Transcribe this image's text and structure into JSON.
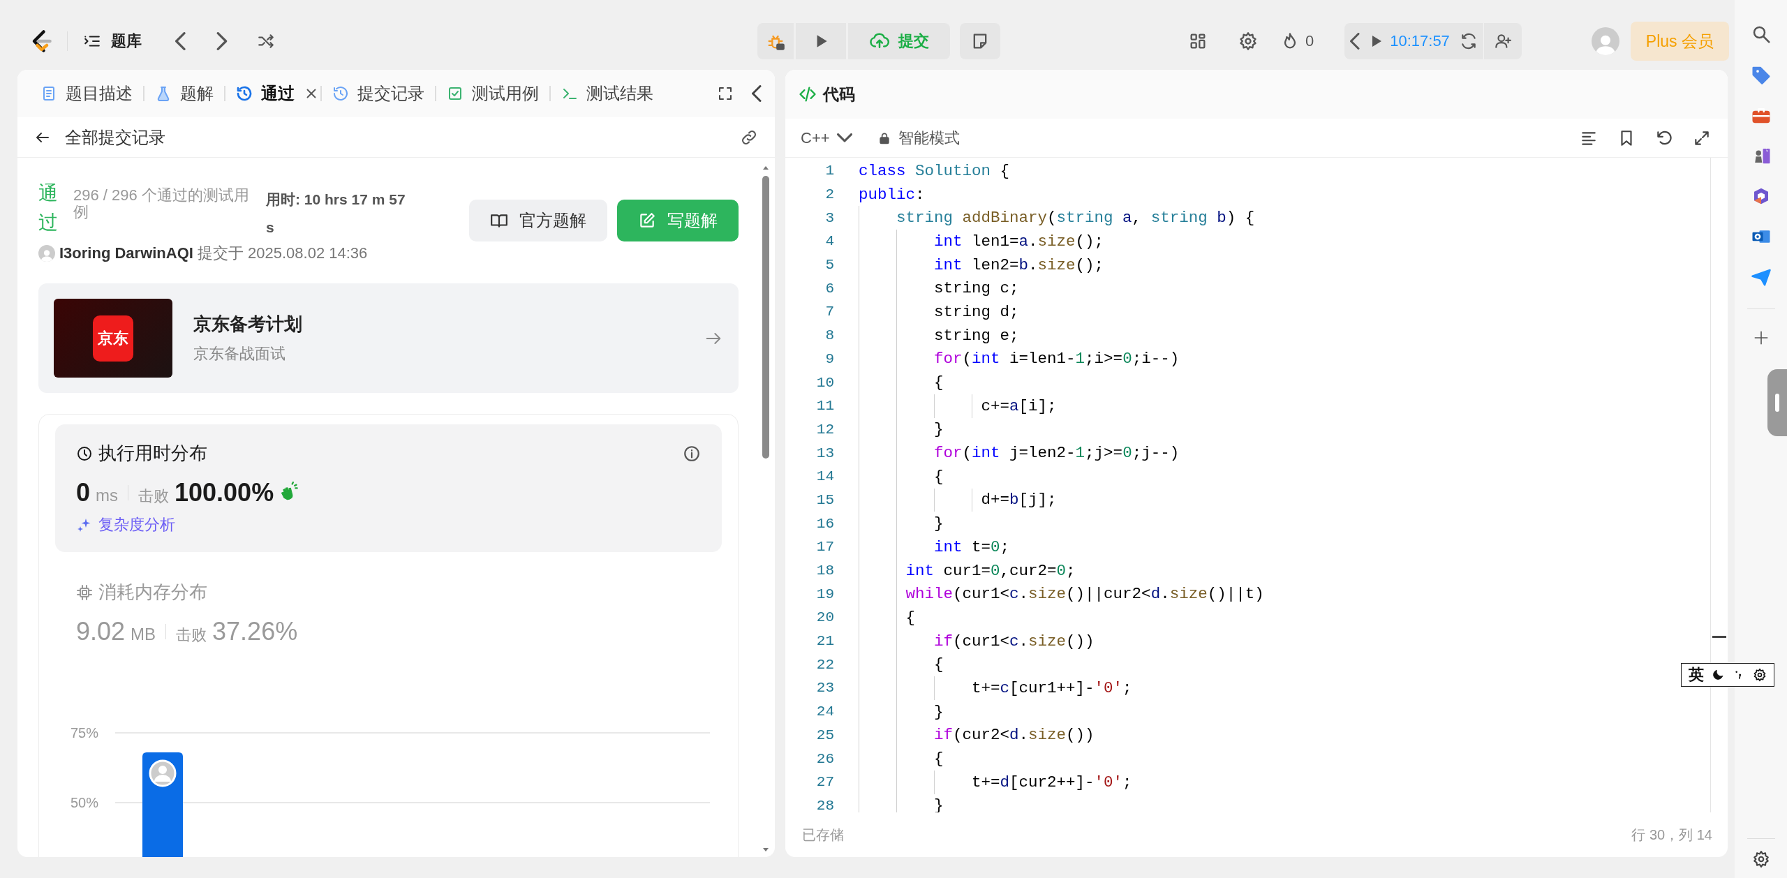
{
  "nav": {
    "bank_label": "题库",
    "submit_label": "提交",
    "streak_count": "0",
    "timer": "10:17:57",
    "plus_label": "Plus 会员"
  },
  "left_tabs": [
    {
      "label": "题目描述",
      "kind": "doc",
      "selected": false,
      "closable": false
    },
    {
      "label": "题解",
      "kind": "flask",
      "selected": false,
      "closable": false
    },
    {
      "label": "通过",
      "kind": "history",
      "selected": true,
      "closable": true
    },
    {
      "label": "提交记录",
      "kind": "history",
      "selected": false,
      "closable": false
    },
    {
      "label": "测试用例",
      "kind": "checkbox",
      "selected": false,
      "closable": false
    },
    {
      "label": "测试结果",
      "kind": "terminal",
      "selected": false,
      "closable": false
    }
  ],
  "submission_header": {
    "back_label": "全部提交记录"
  },
  "result": {
    "status": "通过",
    "cases": "296 / 296 个通过的测试用例",
    "runtime": "用时: 10 hrs 17 m 57 s",
    "official_button": "官方题解",
    "write_button": "写题解",
    "author": "I3oring DarwinAQI",
    "submitted": "提交于 2025.08.02 14:36"
  },
  "promo": {
    "logo_text": "京东",
    "title": "京东备考计划",
    "subtitle": "京东备战面试"
  },
  "stats": [
    {
      "title": "执行用时分布",
      "value": "0",
      "unit": "ms",
      "beats_label": "击败",
      "beats": "100.00%",
      "analysis_link": "复杂度分析",
      "kind": "runtime",
      "selected": true
    },
    {
      "title": "消耗内存分布",
      "value": "9.02",
      "unit": "MB",
      "beats_label": "击败",
      "beats": "37.26%",
      "kind": "memory",
      "selected": false
    }
  ],
  "distribution_chart": {
    "chart_data": {
      "type": "bar",
      "yticks": [
        {
          "value": 50,
          "label": "50%"
        },
        {
          "value": 75,
          "label": "75%"
        }
      ],
      "ylim": [
        25,
        75
      ],
      "values": [
        68
      ]
    }
  },
  "editor": {
    "title": "代码",
    "language": "C++",
    "mode": "智能模式",
    "status": "已存储",
    "cursor": "行 30，列 14",
    "lines": [
      {
        "number": "1",
        "tokens": [
          {
            "text": "class",
            "kind": "kw"
          },
          {
            "text": " Solution",
            "kind": "type"
          },
          {
            "text": " {",
            "kind": "plain"
          }
        ]
      },
      {
        "number": "2",
        "tokens": [
          {
            "text": "public",
            "kind": "kw"
          },
          {
            "text": ":",
            "kind": "plain"
          }
        ]
      },
      {
        "number": "3",
        "tokens": [
          {
            "text": "    string",
            "kind": "type"
          },
          {
            "text": " addBinary",
            "kind": "fn"
          },
          {
            "text": "(",
            "kind": "plain"
          },
          {
            "text": "string",
            "kind": "type"
          },
          {
            "text": " a",
            "kind": "var"
          },
          {
            "text": ", ",
            "kind": "plain"
          },
          {
            "text": "string",
            "kind": "type"
          },
          {
            "text": " b",
            "kind": "var"
          },
          {
            "text": ") {",
            "kind": "plain"
          }
        ]
      },
      {
        "number": "4",
        "tokens": [
          {
            "text": "        int",
            "kind": "kw"
          },
          {
            "text": " len1=",
            "kind": "plain"
          },
          {
            "text": "a",
            "kind": "var"
          },
          {
            "text": ".",
            "kind": "plain"
          },
          {
            "text": "size",
            "kind": "fn"
          },
          {
            "text": "();",
            "kind": "plain"
          }
        ]
      },
      {
        "number": "5",
        "tokens": [
          {
            "text": "        int",
            "kind": "kw"
          },
          {
            "text": " len2=",
            "kind": "plain"
          },
          {
            "text": "b",
            "kind": "var"
          },
          {
            "text": ".",
            "kind": "plain"
          },
          {
            "text": "size",
            "kind": "fn"
          },
          {
            "text": "();",
            "kind": "plain"
          }
        ]
      },
      {
        "number": "6",
        "tokens": [
          {
            "text": "        string c;",
            "kind": "plain"
          }
        ]
      },
      {
        "number": "7",
        "tokens": [
          {
            "text": "        string d;",
            "kind": "plain"
          }
        ]
      },
      {
        "number": "8",
        "tokens": [
          {
            "text": "        string e;",
            "kind": "plain"
          }
        ]
      },
      {
        "number": "9",
        "tokens": [
          {
            "text": "        for",
            "kind": "ctrl"
          },
          {
            "text": "(",
            "kind": "plain"
          },
          {
            "text": "int",
            "kind": "kw"
          },
          {
            "text": " i=len1-",
            "kind": "plain"
          },
          {
            "text": "1",
            "kind": "num"
          },
          {
            "text": ";i>=",
            "kind": "plain"
          },
          {
            "text": "0",
            "kind": "num"
          },
          {
            "text": ";i--)",
            "kind": "plain"
          }
        ]
      },
      {
        "number": "10",
        "tokens": [
          {
            "text": "        {",
            "kind": "plain"
          }
        ]
      },
      {
        "number": "11",
        "tokens": [
          {
            "text": "             c+=",
            "kind": "plain"
          },
          {
            "text": "a",
            "kind": "var"
          },
          {
            "text": "[i];",
            "kind": "plain"
          }
        ]
      },
      {
        "number": "12",
        "tokens": [
          {
            "text": "        }",
            "kind": "plain"
          }
        ]
      },
      {
        "number": "13",
        "tokens": [
          {
            "text": "        for",
            "kind": "ctrl"
          },
          {
            "text": "(",
            "kind": "plain"
          },
          {
            "text": "int",
            "kind": "kw"
          },
          {
            "text": " j=len2-",
            "kind": "plain"
          },
          {
            "text": "1",
            "kind": "num"
          },
          {
            "text": ";j>=",
            "kind": "plain"
          },
          {
            "text": "0",
            "kind": "num"
          },
          {
            "text": ";j--)",
            "kind": "plain"
          }
        ]
      },
      {
        "number": "14",
        "tokens": [
          {
            "text": "        {",
            "kind": "plain"
          }
        ]
      },
      {
        "number": "15",
        "tokens": [
          {
            "text": "             d+=",
            "kind": "plain"
          },
          {
            "text": "b",
            "kind": "var"
          },
          {
            "text": "[j];",
            "kind": "plain"
          }
        ]
      },
      {
        "number": "16",
        "tokens": [
          {
            "text": "        }",
            "kind": "plain"
          }
        ]
      },
      {
        "number": "17",
        "tokens": [
          {
            "text": "        int",
            "kind": "kw"
          },
          {
            "text": " t=",
            "kind": "plain"
          },
          {
            "text": "0",
            "kind": "num"
          },
          {
            "text": ";",
            "kind": "plain"
          }
        ]
      },
      {
        "number": "18",
        "tokens": [
          {
            "text": "     int",
            "kind": "kw"
          },
          {
            "text": " cur1=",
            "kind": "plain"
          },
          {
            "text": "0",
            "kind": "num"
          },
          {
            "text": ",cur2=",
            "kind": "plain"
          },
          {
            "text": "0",
            "kind": "num"
          },
          {
            "text": ";",
            "kind": "plain"
          }
        ]
      },
      {
        "number": "19",
        "tokens": [
          {
            "text": "     while",
            "kind": "ctrl"
          },
          {
            "text": "(cur1<",
            "kind": "plain"
          },
          {
            "text": "c",
            "kind": "var"
          },
          {
            "text": ".",
            "kind": "plain"
          },
          {
            "text": "size",
            "kind": "fn"
          },
          {
            "text": "()||cur2<",
            "kind": "plain"
          },
          {
            "text": "d",
            "kind": "var"
          },
          {
            "text": ".",
            "kind": "plain"
          },
          {
            "text": "size",
            "kind": "fn"
          },
          {
            "text": "()||t)",
            "kind": "plain"
          }
        ]
      },
      {
        "number": "20",
        "tokens": [
          {
            "text": "     {",
            "kind": "plain"
          }
        ]
      },
      {
        "number": "21",
        "tokens": [
          {
            "text": "        if",
            "kind": "ctrl"
          },
          {
            "text": "(cur1<",
            "kind": "plain"
          },
          {
            "text": "c",
            "kind": "var"
          },
          {
            "text": ".",
            "kind": "plain"
          },
          {
            "text": "size",
            "kind": "fn"
          },
          {
            "text": "())",
            "kind": "plain"
          }
        ]
      },
      {
        "number": "22",
        "tokens": [
          {
            "text": "        {",
            "kind": "plain"
          }
        ]
      },
      {
        "number": "23",
        "tokens": [
          {
            "text": "            t+=",
            "kind": "plain"
          },
          {
            "text": "c",
            "kind": "var"
          },
          {
            "text": "[cur1++]-",
            "kind": "plain"
          },
          {
            "text": "'0'",
            "kind": "str"
          },
          {
            "text": ";",
            "kind": "plain"
          }
        ]
      },
      {
        "number": "24",
        "tokens": [
          {
            "text": "        }",
            "kind": "plain"
          }
        ]
      },
      {
        "number": "25",
        "tokens": [
          {
            "text": "        if",
            "kind": "ctrl"
          },
          {
            "text": "(cur2<",
            "kind": "plain"
          },
          {
            "text": "d",
            "kind": "var"
          },
          {
            "text": ".",
            "kind": "plain"
          },
          {
            "text": "size",
            "kind": "fn"
          },
          {
            "text": "())",
            "kind": "plain"
          }
        ]
      },
      {
        "number": "26",
        "tokens": [
          {
            "text": "        {",
            "kind": "plain"
          }
        ]
      },
      {
        "number": "27",
        "tokens": [
          {
            "text": "            t+=",
            "kind": "plain"
          },
          {
            "text": "d",
            "kind": "var"
          },
          {
            "text": "[cur2++]-",
            "kind": "plain"
          },
          {
            "text": "'0'",
            "kind": "str"
          },
          {
            "text": ";",
            "kind": "plain"
          }
        ]
      },
      {
        "number": "28",
        "tokens": [
          {
            "text": "        }",
            "kind": "plain"
          }
        ]
      }
    ]
  },
  "ime_bar": {
    "language": "英"
  }
}
